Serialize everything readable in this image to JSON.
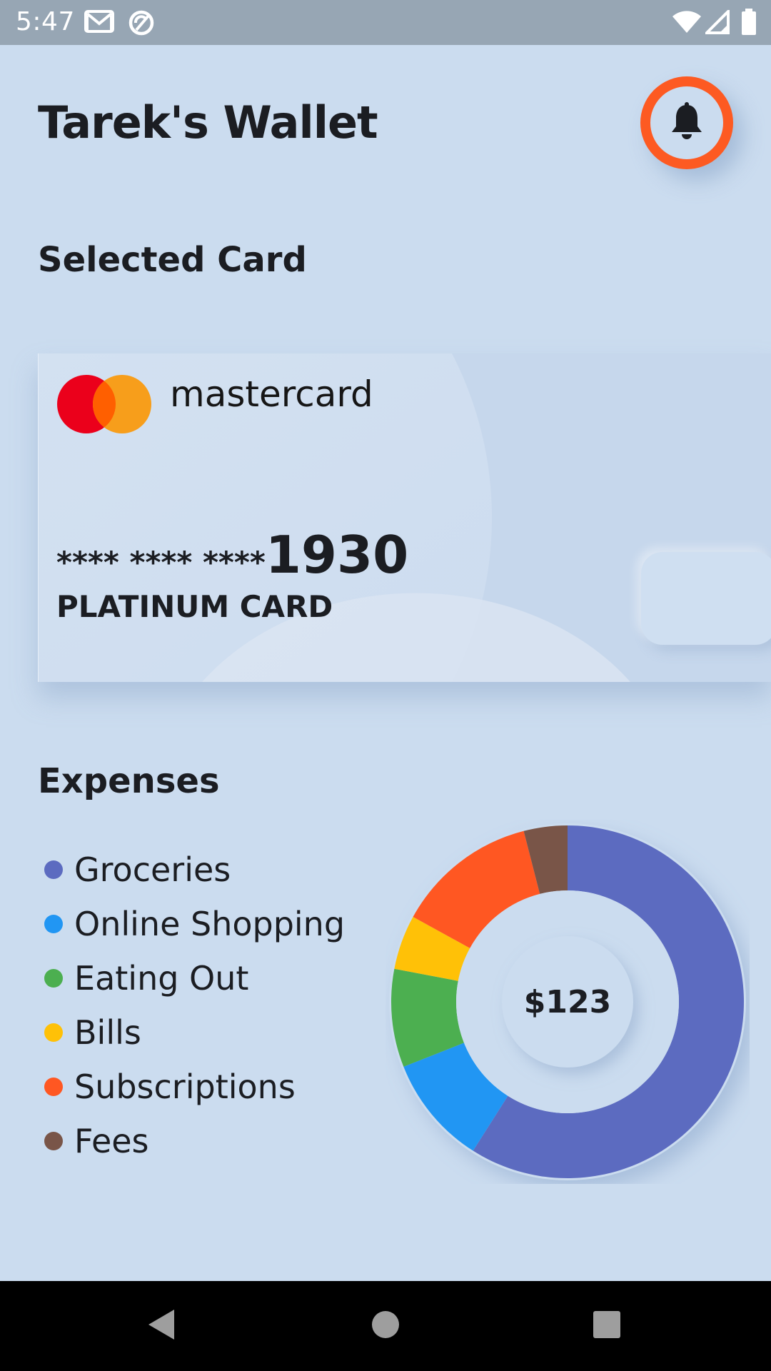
{
  "status_bar": {
    "time": "5:47",
    "left_icons": [
      "gmail-icon",
      "sync-disabled-icon"
    ],
    "right_icons": [
      "wifi-icon",
      "signal-icon",
      "battery-icon"
    ]
  },
  "header": {
    "title": "Tarek's Wallet",
    "notification_icon": "bell-icon",
    "accent_color": "#fd5a22"
  },
  "selected_card": {
    "section_title": "Selected Card",
    "brand": "mastercard",
    "brand_logo_colors": [
      "#eb001b",
      "#f79e1b",
      "#ff5f00"
    ],
    "number_masked": "**** **** ****",
    "number_last4": "1930",
    "card_type": "PLATINUM CARD"
  },
  "expenses": {
    "section_title": "Expenses",
    "total": "$123",
    "categories": [
      {
        "label": "Groceries",
        "color": "#5c6bc0"
      },
      {
        "label": "Online Shopping",
        "color": "#2196f3"
      },
      {
        "label": "Eating Out",
        "color": "#4caf50"
      },
      {
        "label": "Bills",
        "color": "#ffc107"
      },
      {
        "label": "Subscriptions",
        "color": "#ff5722"
      },
      {
        "label": "Fees",
        "color": "#795548"
      }
    ]
  },
  "chart_data": {
    "type": "pie",
    "categories": [
      "Groceries",
      "Online Shopping",
      "Eating Out",
      "Bills",
      "Subscriptions",
      "Fees"
    ],
    "values": [
      59,
      10,
      9,
      5,
      13,
      4
    ],
    "colors": [
      "#5c6bc0",
      "#2196f3",
      "#4caf50",
      "#ffc107",
      "#ff5722",
      "#795548"
    ],
    "title": "",
    "center_label": "$123"
  },
  "nav_bar": {
    "buttons": [
      "back-icon",
      "home-icon",
      "recents-icon"
    ]
  }
}
